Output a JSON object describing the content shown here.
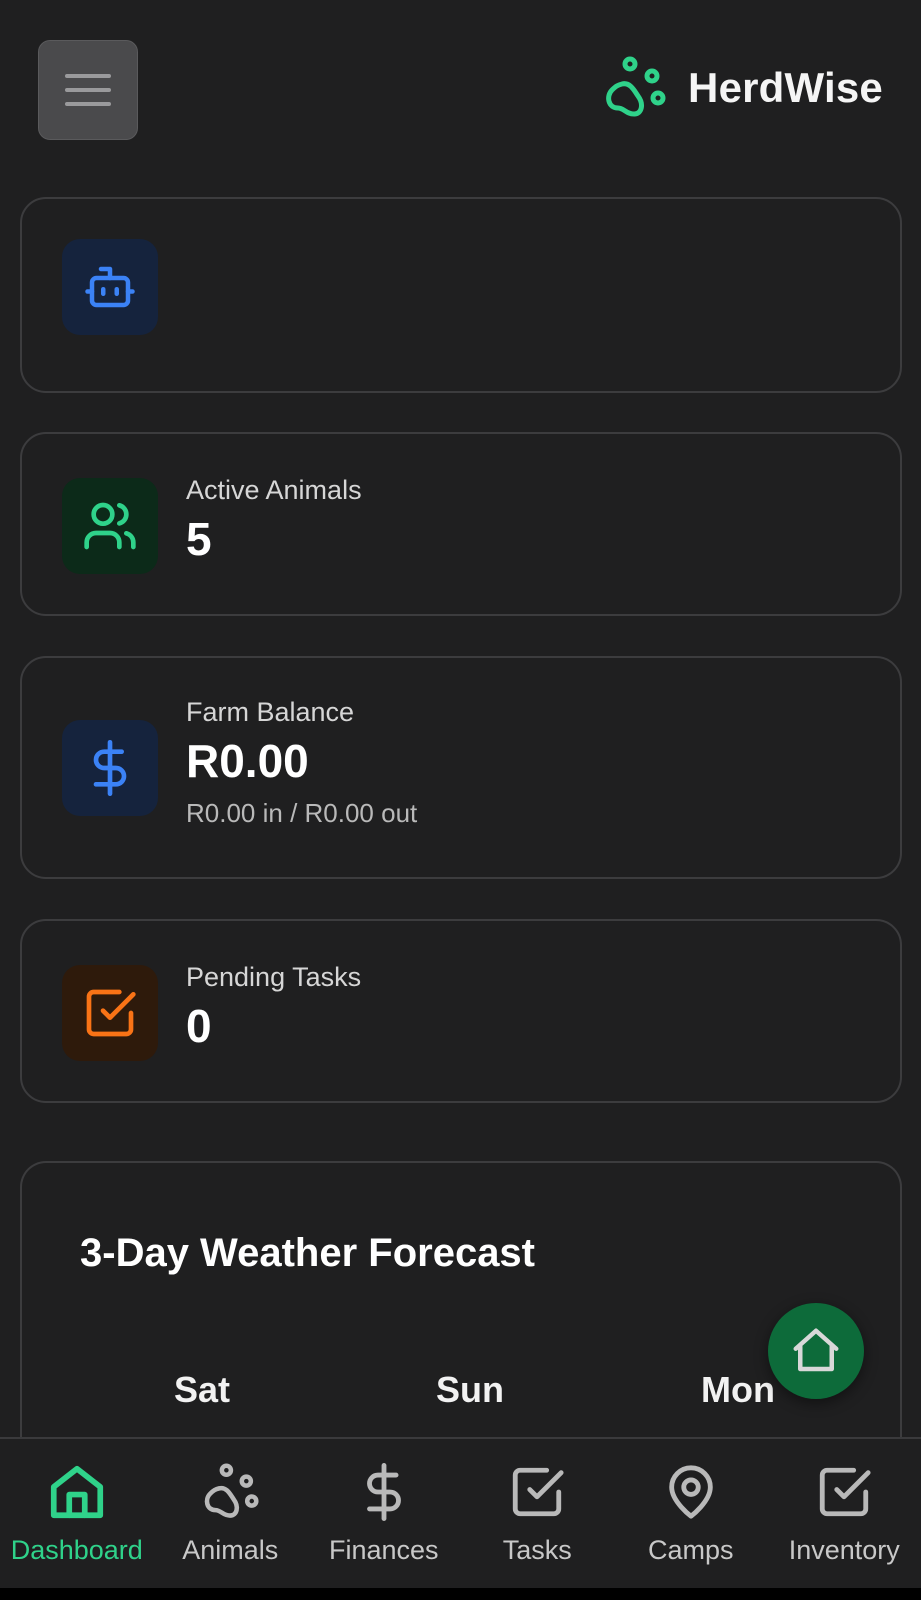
{
  "header": {
    "app_name": "HerdWise",
    "logo_icon": "paw-icon",
    "menu_icon": "hamburger-menu-icon"
  },
  "cards": {
    "assistant": {
      "icon": "robot-icon"
    },
    "active_animals": {
      "icon": "users-icon",
      "label": "Active Animals",
      "value": "5"
    },
    "farm_balance": {
      "icon": "dollar-icon",
      "label": "Farm Balance",
      "value": "R0.00",
      "sub": "R0.00 in / R0.00 out"
    },
    "pending_tasks": {
      "icon": "check-square-icon",
      "label": "Pending Tasks",
      "value": "0"
    }
  },
  "weather": {
    "title": "3-Day Weather Forecast",
    "days": [
      "Sat",
      "Sun",
      "Mon"
    ]
  },
  "fab": {
    "icon": "home-icon"
  },
  "bottom_nav": {
    "items": [
      {
        "label": "Dashboard",
        "icon": "home-icon",
        "active": true
      },
      {
        "label": "Animals",
        "icon": "paw-icon",
        "active": false
      },
      {
        "label": "Finances",
        "icon": "dollar-icon",
        "active": false
      },
      {
        "label": "Tasks",
        "icon": "check-square-icon",
        "active": false
      },
      {
        "label": "Camps",
        "icon": "map-pin-icon",
        "active": false
      },
      {
        "label": "Inventory",
        "icon": "check-square-icon",
        "active": false
      }
    ]
  },
  "colors": {
    "background": "#1f1f20",
    "accent_green": "#2fd28a",
    "fab_green": "#0d6b3a",
    "blue_icon": "#3b82f6",
    "orange_icon": "#f97316",
    "card_border": "#3c3c3e"
  }
}
